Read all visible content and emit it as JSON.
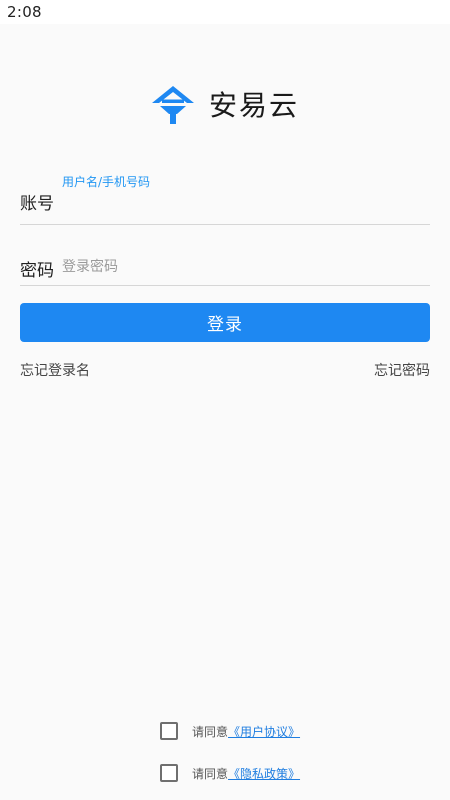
{
  "status_bar": {
    "time": "2:08"
  },
  "brand": {
    "name": "安易云",
    "logo_icon": "anyiyun-logo-icon",
    "accent": "#1e88f2"
  },
  "account": {
    "label": "账号",
    "floating_hint": "用户名/手机号码",
    "value": ""
  },
  "password": {
    "label": "密码",
    "placeholder": "登录密码",
    "value": ""
  },
  "login_button": {
    "label": "登录",
    "color": "#1e88f2"
  },
  "links": {
    "forgot_username": "忘记登录名",
    "forgot_password": "忘记密码"
  },
  "agreements": [
    {
      "prefix": "请同意",
      "link": "《用户协议》",
      "checked": false
    },
    {
      "prefix": "请同意",
      "link": "《隐私政策》",
      "checked": false
    }
  ]
}
